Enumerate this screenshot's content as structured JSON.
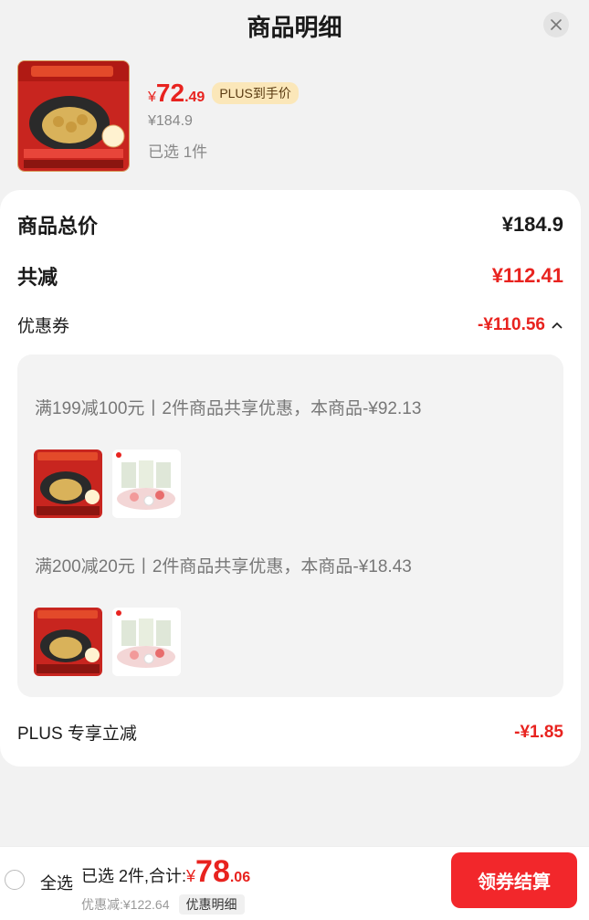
{
  "header": {
    "title": "商品明细",
    "close_icon": "close-icon"
  },
  "product": {
    "currency": "¥",
    "price_int": "72",
    "price_dec": ".49",
    "plus_badge": "PLUS到手价",
    "original_price": "¥184.9",
    "selected": "已选 1件",
    "image_icon": "product-image-seafood-platter"
  },
  "breakdown": {
    "total_label": "商品总价",
    "total_value": "¥184.9",
    "reduce_label": "共减",
    "reduce_value": "¥112.41",
    "coupon_label": "优惠券",
    "coupon_value": "-¥110.56",
    "coupon_toggle_icon": "chevron-up-icon",
    "plus_label": "PLUS 专享立减",
    "plus_value": "-¥1.85"
  },
  "coupons": [
    {
      "text": "满199减100元丨2件商品共享优惠，本商品-¥92.13"
    },
    {
      "text": "满200减20元丨2件商品共享优惠，本商品-¥18.43"
    }
  ],
  "bottom": {
    "select_all": "全选",
    "summary_label": "已选 2件,合计:",
    "currency": "¥",
    "total_int": "78",
    "total_dec": ".06",
    "discount_text": "优惠减:¥122.64",
    "detail_tag": "优惠明细",
    "checkout": "领券结算"
  },
  "colors": {
    "accent": "#e8231f",
    "button": "#f2272b",
    "plus_badge_bg": "#fbe7b9"
  }
}
